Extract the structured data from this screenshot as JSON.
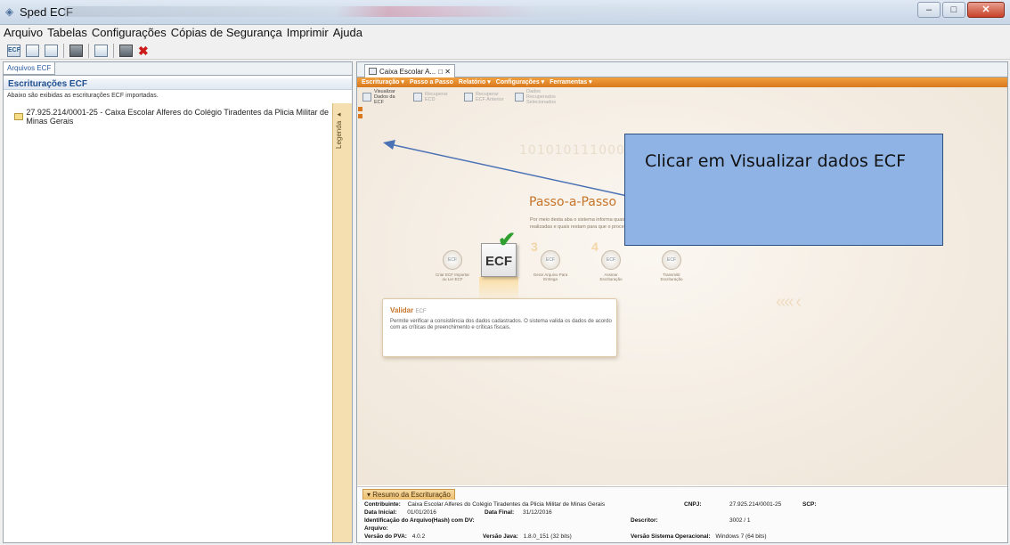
{
  "window": {
    "title": "Sped ECF",
    "buttons": {
      "minimize": "–",
      "maximize": "□",
      "close": "✕"
    }
  },
  "menubar": {
    "items": [
      "Arquivo",
      "Tabelas",
      "Configurações",
      "Cópias de Segurança",
      "Imprimir",
      "Ajuda"
    ]
  },
  "toolbar": {
    "icons": [
      "ecf-new-icon",
      "ecf-import-icon",
      "ecf-export-icon",
      "delete-icon",
      "edit-icon",
      "report-icon",
      "close-icon"
    ],
    "labels": {
      "ecf": "ECF",
      "close": "✖"
    }
  },
  "left_panel": {
    "tab_label": "Arquivos ECF",
    "header": "Escriturações ECF",
    "subtitle": "Abaixo são exibidas as escriturações ECF importadas.",
    "tree_item": "27.925.214/0001-25 - Caixa Escolar Alferes do Colégio Tiradentes da Plicia Militar de Minas Gerais",
    "legend_label": "Legenda ▸"
  },
  "right_panel": {
    "tab_label": "Caixa Escolar A...",
    "menu": [
      "Escrituração ▾",
      "Passo a Passo",
      "Relatório ▾",
      "Configurações ▾",
      "Ferramentas ▾"
    ],
    "subtoolbar": [
      "Visualizar Dados da ECF",
      "Recuperar ECD",
      "Recuperar ECF Anterior",
      "Dados Recuperados Selecionados"
    ],
    "binary_text": "1010101110001",
    "passo_title": "Passo-a-Passo",
    "passo_desc": "Por meio desta aba o sistema informa quais etapas já foram realizadas e quais restam para que o processo seja concluído.",
    "steps": [
      {
        "num": "1",
        "label": "Criar ECF Importar ou Ler ECF"
      },
      {
        "num": "2",
        "label": ""
      },
      {
        "num": "3",
        "label": "Gerar Arquivo Para Entrega"
      },
      {
        "num": "4",
        "label": "Assinar Escrituração"
      },
      {
        "num": "5",
        "label": "Transmitir Escrituração"
      }
    ],
    "ecf_badge": "ECF",
    "chevrons": "‹‹‹‹  ‹",
    "validar": {
      "title": "Validar",
      "title_suffix": "ECF",
      "text": "Permite verificar a consistência dos dados cadastrados. O sistema valida os dados de acordo com as críticas de preenchimento e críticas fiscais."
    }
  },
  "callout": {
    "text": "Clicar em Visualizar dados ECF"
  },
  "summary": {
    "tab_label": "▾ Resumo da Escrituração",
    "contribuinte_label": "Contribuinte:",
    "contribuinte_value": "Caixa Escolar Alferes do Colégio Tiradentes da Plicia Militar de Minas Gerais",
    "cnpj_label": "CNPJ:",
    "cnpj_value": "27.925.214/0001-25",
    "scp_label": "SCP:",
    "data_inicial_label": "Data Inicial:",
    "data_inicial_value": "01/01/2016",
    "data_final_label": "Data Final:",
    "data_final_value": "31/12/2016",
    "hash_label": "Identificação do Arquivo(Hash) com DV:",
    "descritor_label": "Descritor:",
    "descritor_value": "3002 / 1",
    "arquivo_label": "Arquivo:",
    "versao_pva_label": "Versão do PVA:",
    "versao_pva_value": "4.0.2",
    "versao_java_label": "Versão Java:",
    "versao_java_value": "1.8.0_151 (32 bits)",
    "versao_so_label": "Versão Sistema Operacional:",
    "versao_so_value": "Windows 7 (64 bits)"
  }
}
